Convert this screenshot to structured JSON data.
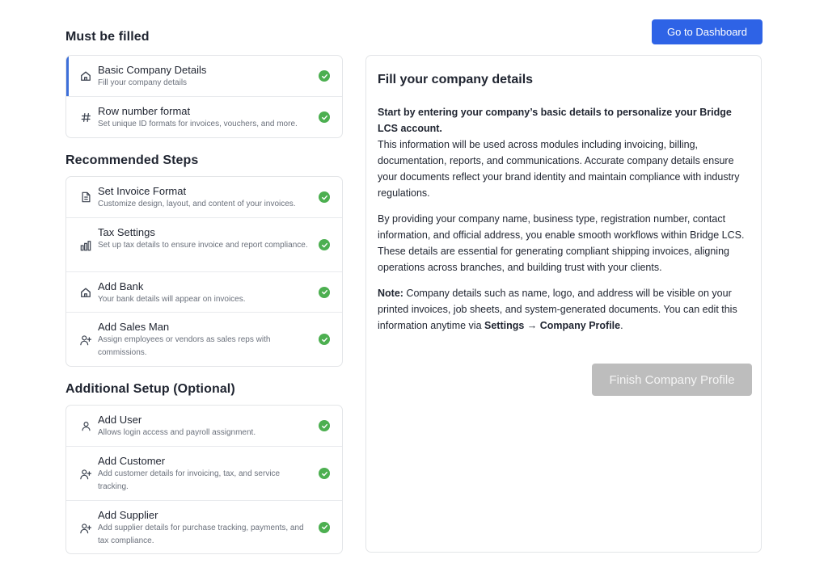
{
  "header": {
    "dashboard_button": "Go to Dashboard"
  },
  "colors": {
    "accent": "#2e63e6",
    "check": "#4caf50",
    "active_marker": "#3d6fd9",
    "disabled_button": "#bdbdbd"
  },
  "must_be_filled": {
    "title": "Must be filled",
    "items": [
      {
        "icon": "home-icon",
        "title": "Basic Company Details",
        "desc": "Fill your company details",
        "done": true,
        "active": true
      },
      {
        "icon": "hash-icon",
        "title": "Row number format",
        "desc": "Set unique ID formats for invoices, vouchers, and more.",
        "done": true
      }
    ]
  },
  "recommended": {
    "title": "Recommended Steps",
    "items": [
      {
        "icon": "document-icon",
        "title": "Set Invoice Format",
        "desc": "Customize design, layout, and content of your invoices.",
        "done": true
      },
      {
        "icon": "bar-chart-icon",
        "title": "Tax Settings",
        "desc": "Set up tax details to ensure invoice and report compliance.",
        "done": true
      },
      {
        "icon": "bank-icon",
        "title": "Add Bank",
        "desc": "Your bank details will appear on invoices.",
        "done": true
      },
      {
        "icon": "user-add-icon",
        "title": "Add Sales Man",
        "desc": "Assign employees or vendors as sales reps with commissions.",
        "done": true
      }
    ]
  },
  "additional": {
    "title": "Additional Setup (Optional)",
    "items": [
      {
        "icon": "user-icon",
        "title": "Add User",
        "desc": "Allows login access and payroll assignment.",
        "done": true
      },
      {
        "icon": "user-add-icon",
        "title": "Add Customer",
        "desc": "Add customer details for invoicing, tax, and service tracking.",
        "done": true
      },
      {
        "icon": "user-add-icon",
        "title": "Add Supplier",
        "desc": "Add supplier details for purchase tracking, payments, and tax compliance.",
        "done": true
      }
    ]
  },
  "panel": {
    "title": "Fill your company details",
    "intro_bold": "Start by entering your company’s basic details to personalize your Bridge LCS account.",
    "intro_text": "This information will be used across modules including invoicing, billing, documentation, reports, and communications. Accurate company details ensure your documents reflect your brand identity and maintain compliance with industry regulations.",
    "paragraph2": "By providing your company name, business type, registration number, contact information, and official address, you enable smooth workflows within Bridge LCS. These details are essential for generating compliant shipping invoices, aligning operations across branches, and building trust with your clients.",
    "note_label": "Note:",
    "note_text": " Company details such as name, logo, and address will be visible on your printed invoices, job sheets, and system-generated documents. You can edit this information anytime via ",
    "note_path": "Settings → Company Profile",
    "note_end": ".",
    "finish_button": "Finish Company Profile"
  }
}
